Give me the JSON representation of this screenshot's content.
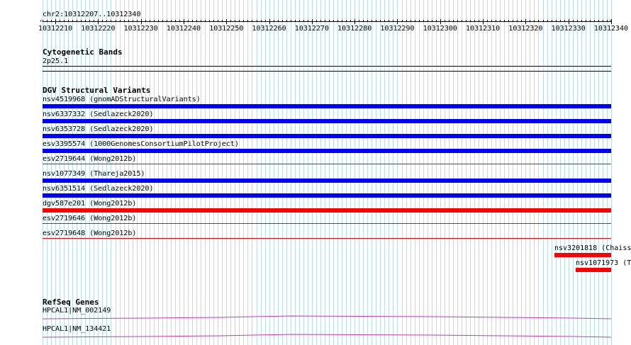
{
  "location": "chr2:10312207..10312340",
  "ruler": {
    "start": 10312207,
    "end": 10312340,
    "labels": [
      "10312210",
      "10312220",
      "10312230",
      "10312240",
      "10312250",
      "10312260",
      "10312270",
      "10312280",
      "10312290",
      "10312300",
      "10312310",
      "10312320",
      "10312330",
      "10312340"
    ]
  },
  "tracks": {
    "cytoband": {
      "title": "Cytogenetic Bands",
      "band": "2p25.1"
    },
    "dgv": {
      "title": "DGV Structural Variants",
      "full_width": [
        {
          "label": "nsv4519968 (gnomADStructuralVariants)",
          "color": "#0000ff"
        },
        {
          "label": "nsv6337332 (Sedlazeck2020)",
          "color": "#0000ff"
        },
        {
          "label": "nsv6353728 (Sedlazeck2020)",
          "color": "#0000ff"
        },
        {
          "label": "esv3395574 (1000GenomesConsortiumPilotProject)",
          "color": "#0000ff"
        },
        {
          "label": "esv2719644 (Wong2012b)",
          "color": "#ff0000"
        },
        {
          "label": "nsv1077349 (Thareja2015)",
          "color": "#0000ff"
        },
        {
          "label": "nsv6351514 (Sedlazeck2020)",
          "color": "#0000ff"
        },
        {
          "label": "dgv587e201 (Wong2012b)",
          "color": "#ff0000"
        },
        {
          "label": "esv2719646 (Wong2012b)",
          "color": "#ff0000"
        },
        {
          "label": "esv2719648 (Wong2012b)",
          "color": "#ff0000"
        }
      ],
      "partial": [
        {
          "label": "nsv3201818 (Chaiss",
          "color": "#ff0000"
        },
        {
          "label": "nsv1071973 (T",
          "color": "#ff0000"
        }
      ]
    },
    "refseq": {
      "title": "RefSeq Genes",
      "genes": [
        {
          "label": "HPCAL1|NM_002149",
          "color": "#cc33cc"
        },
        {
          "label": "HPCAL1|NM_134421",
          "color": "#cc33cc"
        }
      ]
    }
  }
}
